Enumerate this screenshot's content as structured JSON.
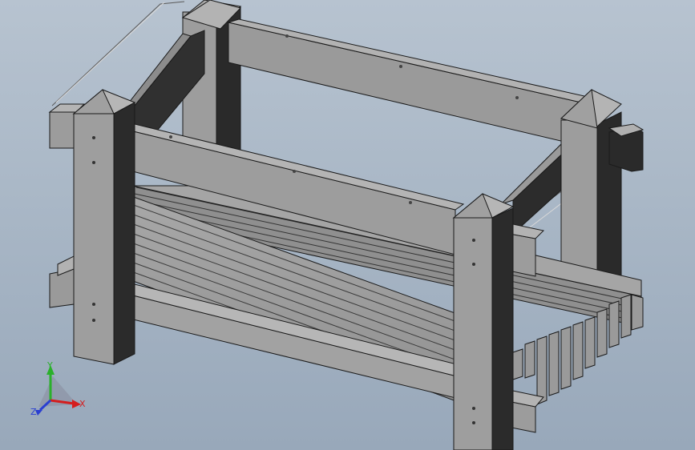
{
  "viewport": {
    "background_top": "#b7c3d0",
    "background_bottom": "#98a8ba",
    "model_fill_light": "#9c9c9c",
    "model_fill_dark": "#2b2b2b",
    "edge_color": "#1a1a1a"
  },
  "model": {
    "description_icon": "planter-box-frame-model"
  },
  "triad": {
    "x_label": "X",
    "y_label": "Y",
    "z_label": "Z",
    "x_color": "#d41e1e",
    "y_color": "#2bb02b",
    "z_color": "#2a3fd1"
  }
}
